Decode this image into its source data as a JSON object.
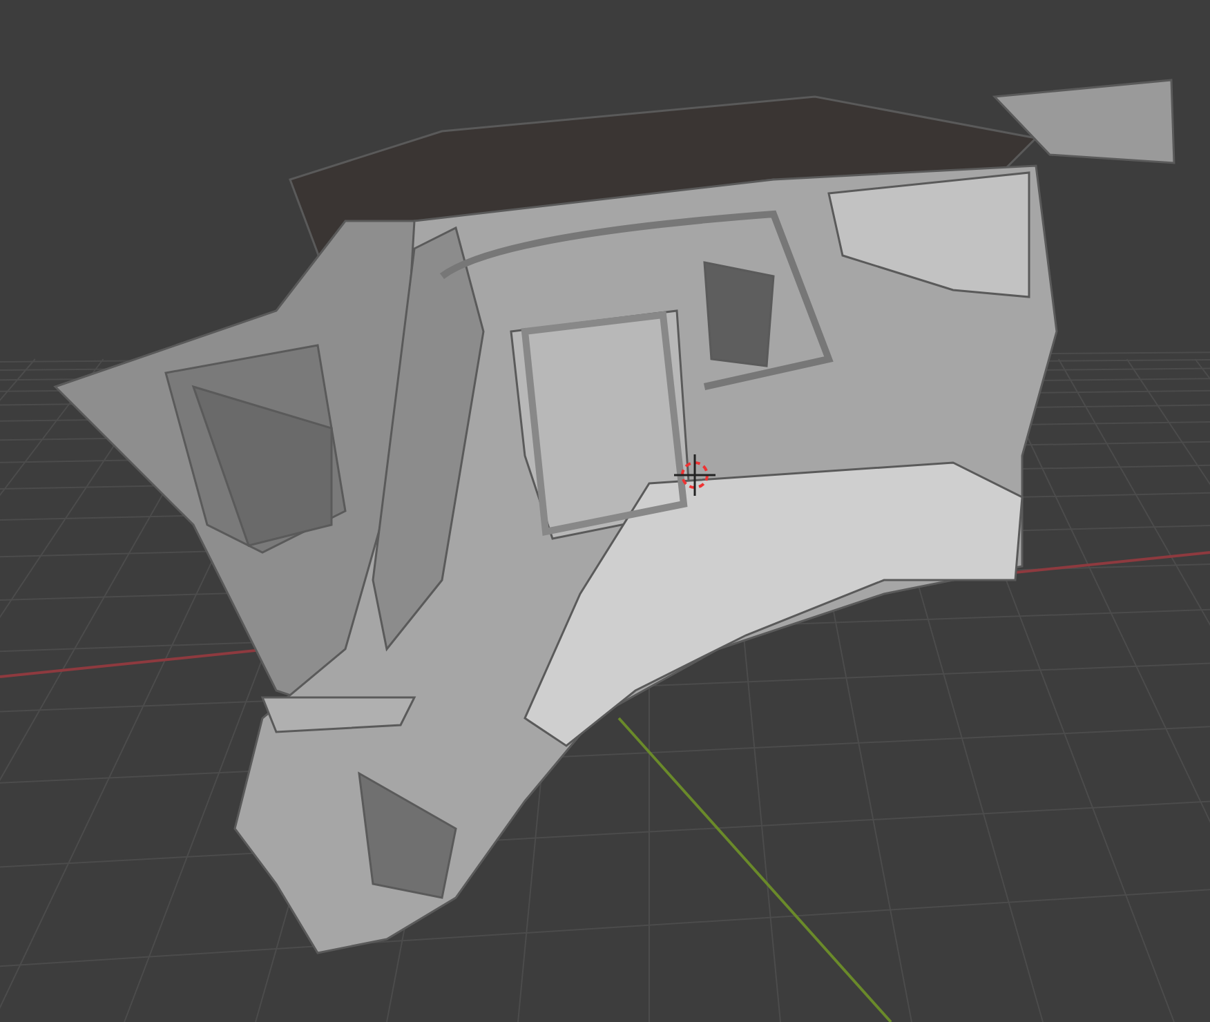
{
  "viewport": {
    "show_grid": true,
    "show_axes": true,
    "show_cursor": true,
    "show_mesh": true
  }
}
